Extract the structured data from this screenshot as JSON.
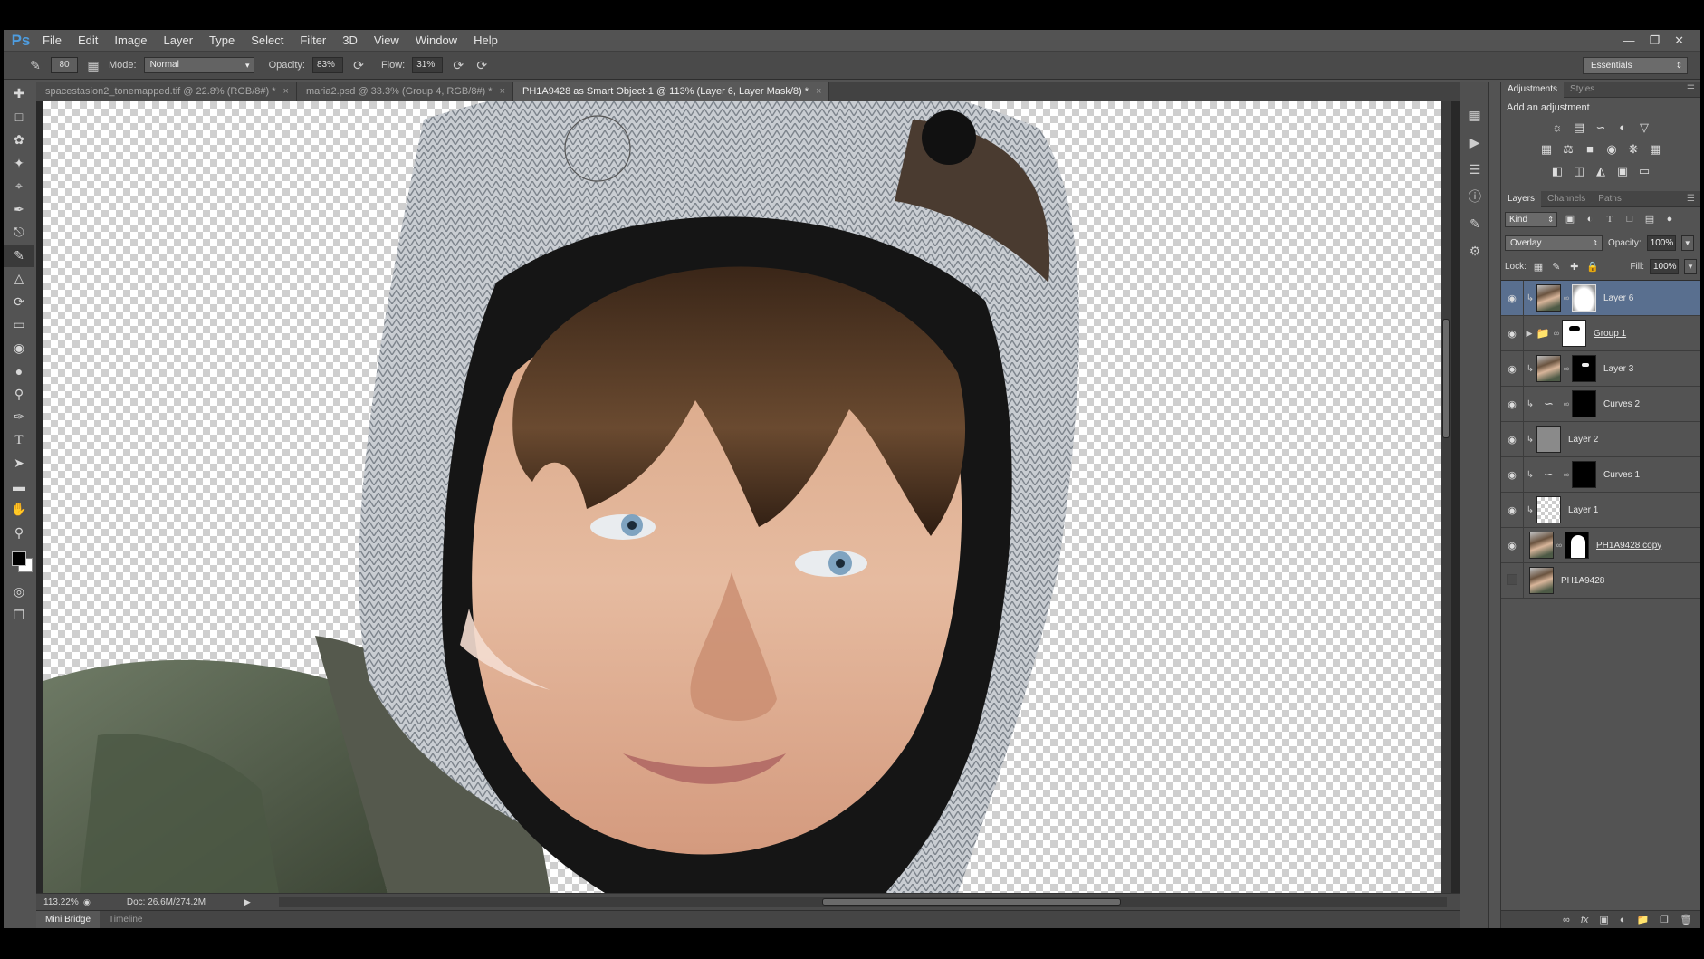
{
  "app": {
    "logo": "Ps"
  },
  "menu": [
    "File",
    "Edit",
    "Image",
    "Layer",
    "Type",
    "Select",
    "Filter",
    "3D",
    "View",
    "Window",
    "Help"
  ],
  "window_controls": [
    "minimize",
    "restore",
    "close"
  ],
  "options": {
    "brush_size": "80",
    "mode_label": "Mode:",
    "mode_value": "Normal",
    "opacity_label": "Opacity:",
    "opacity_value": "83%",
    "flow_label": "Flow:",
    "flow_value": "31%",
    "workspace": "Essentials"
  },
  "tabs": [
    {
      "label": "spacestasion2_tonemapped.tif @ 22.8% (RGB/8#) *",
      "active": false
    },
    {
      "label": "maria2.psd @ 33.3% (Group 4, RGB/8#) *",
      "active": false
    },
    {
      "label": "PH1A9428 as Smart Object-1 @ 113% (Layer 6, Layer Mask/8) *",
      "active": true
    }
  ],
  "tools": [
    "move-tool-icon",
    "marquee-tool-icon",
    "lasso-tool-icon",
    "quick-select-icon",
    "crop-tool-icon",
    "eyedropper-icon",
    "healing-brush-icon",
    "brush-tool-icon",
    "clone-stamp-icon",
    "history-brush-icon",
    "eraser-icon",
    "paint-bucket-icon",
    "blur-tool-icon",
    "dodge-tool-icon",
    "pen-tool-icon",
    "type-tool-icon",
    "path-select-icon",
    "shape-tool-icon",
    "hand-tool-icon",
    "zoom-tool-icon"
  ],
  "status": {
    "zoom": "113.22%",
    "doc": "Doc: 26.6M/274.2M"
  },
  "bottom_tabs": [
    "Mini Bridge",
    "Timeline"
  ],
  "adjustments": {
    "tabs": [
      "Adjustments",
      "Styles"
    ],
    "title": "Add an adjustment"
  },
  "layers_panel": {
    "tabs": [
      "Layers",
      "Channels",
      "Paths"
    ],
    "filter": "Kind",
    "blend_mode": "Overlay",
    "opacity_label": "Opacity:",
    "opacity": "100%",
    "lock_label": "Lock:",
    "fill_label": "Fill:",
    "fill": "100%",
    "layers": [
      {
        "name": "Layer 6",
        "visible": true,
        "selected": true,
        "underline": false
      },
      {
        "name": "Group 1",
        "visible": true,
        "selected": false,
        "underline": true
      },
      {
        "name": "Layer 3",
        "visible": true,
        "selected": false,
        "underline": false
      },
      {
        "name": "Curves 2",
        "visible": true,
        "selected": false,
        "underline": false
      },
      {
        "name": "Layer 2",
        "visible": true,
        "selected": false,
        "underline": false
      },
      {
        "name": "Curves 1",
        "visible": true,
        "selected": false,
        "underline": false
      },
      {
        "name": "Layer 1",
        "visible": true,
        "selected": false,
        "underline": false
      },
      {
        "name": "PH1A9428 copy",
        "visible": true,
        "selected": false,
        "underline": true
      },
      {
        "name": "PH1A9428",
        "visible": false,
        "selected": false,
        "underline": false
      }
    ]
  }
}
